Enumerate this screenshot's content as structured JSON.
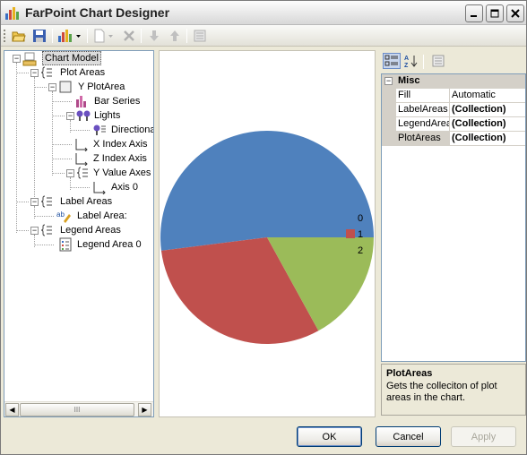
{
  "window": {
    "title": "FarPoint Chart Designer",
    "controls": [
      "minimize",
      "maximize",
      "close"
    ]
  },
  "toolbar": {
    "icons": [
      "open-folder-icon",
      "save-icon",
      "chart-type-icon",
      "new-item-icon",
      "delete-icon",
      "move-down-icon",
      "move-up-icon",
      "properties-icon"
    ]
  },
  "tree": {
    "nodes": [
      {
        "label": "Chart Model",
        "selected": true
      },
      {
        "label": "Plot Areas"
      },
      {
        "label": "Y PlotArea"
      },
      {
        "label": "Bar Series"
      },
      {
        "label": "Lights"
      },
      {
        "label": "DirectionalLight"
      },
      {
        "label": "X Index Axis"
      },
      {
        "label": "Z Index Axis"
      },
      {
        "label": "Y Value Axes"
      },
      {
        "label": "Axis 0"
      },
      {
        "label": "Label Areas"
      },
      {
        "label": "Label Area:"
      },
      {
        "label": "Legend Areas"
      },
      {
        "label": "Legend Area 0"
      }
    ],
    "scrollbar_thumb": "III"
  },
  "chart_data": {
    "type": "pie",
    "categories": [
      "0",
      "1",
      "2"
    ],
    "values": [
      52,
      31,
      17
    ],
    "colors": [
      "#4f81bd",
      "#c0504d",
      "#9bbb59"
    ],
    "title": "",
    "legend_position": "right"
  },
  "properties": {
    "category": "Misc",
    "rows": [
      {
        "name": "Fill",
        "value": "Automatic",
        "bold": false
      },
      {
        "name": "LabelAreas",
        "value": "(Collection)",
        "bold": true
      },
      {
        "name": "LegendAreas",
        "value": "(Collection)",
        "bold": true
      },
      {
        "name": "PlotAreas",
        "value": "(Collection)",
        "bold": true
      }
    ],
    "description_title": "PlotAreas",
    "description_text": "Gets the colleciton of plot areas in the chart."
  },
  "buttons": {
    "ok": "OK",
    "cancel": "Cancel",
    "apply": "Apply"
  }
}
